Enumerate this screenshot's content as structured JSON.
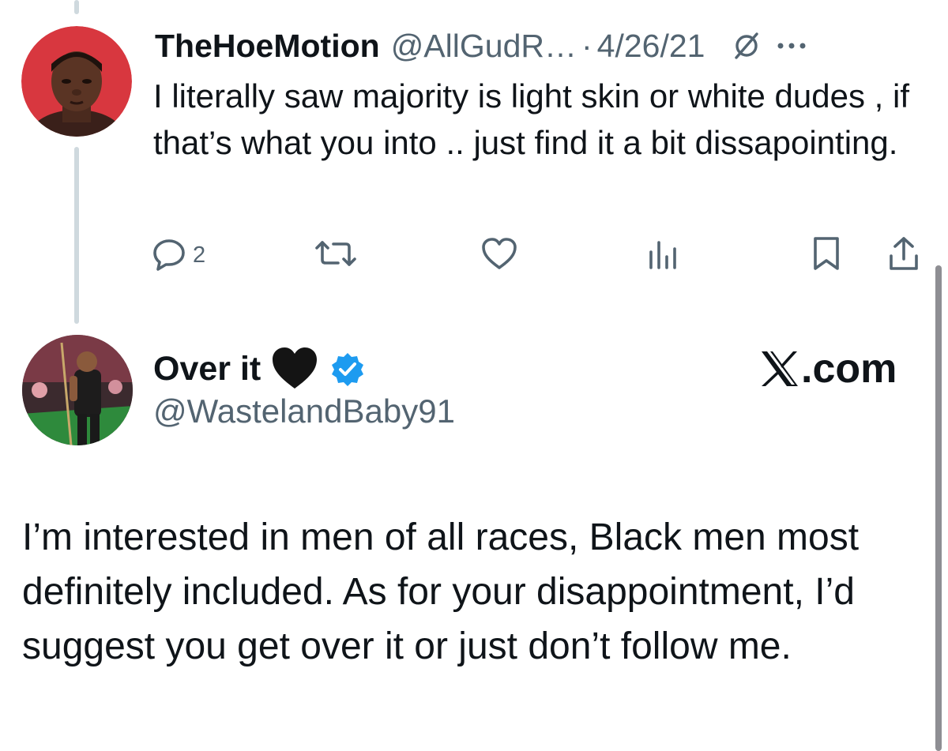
{
  "reply_tweet": {
    "display_name": "TheHoeMotion",
    "handle": "@AllGudR…",
    "separator": "·",
    "date": "4/26/21",
    "grok_icon": "grok-icon",
    "more_icon": "more-dots-icon",
    "body": "I literally saw majority is light skin or white dudes , if that’s what you into .. just find it a bit dissapointing.",
    "actions": {
      "reply": {
        "icon": "reply-icon",
        "count": "2"
      },
      "retweet": {
        "icon": "retweet-icon",
        "count": ""
      },
      "like": {
        "icon": "like-icon",
        "count": ""
      },
      "views": {
        "icon": "views-icon",
        "count": ""
      },
      "bookmark": {
        "icon": "bookmark-icon"
      },
      "share": {
        "icon": "share-icon"
      }
    }
  },
  "main_tweet": {
    "display_name": "Over it",
    "name_emoji": "black-heart-icon",
    "verified_icon": "verified-badge-icon",
    "handle": "@WastelandBaby91",
    "watermark": ".com",
    "body": "I’m interested in men of all races, Black men most definitely included. As for your disappointment, I’d suggest you get over it or just don’t follow me."
  },
  "colors": {
    "text": "#0f1419",
    "secondary": "#536471",
    "thread_line": "#cfd9de",
    "verified": "#1d9bf0",
    "avatar1_bg": "#d8373f",
    "scrollbar": "#8e8e93"
  }
}
